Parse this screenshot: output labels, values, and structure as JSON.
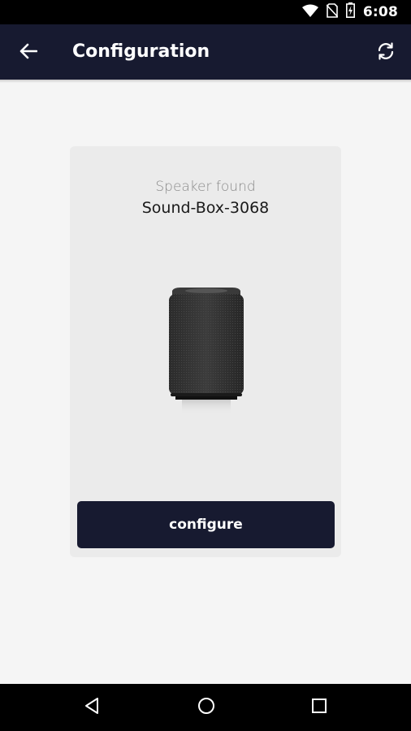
{
  "status_bar": {
    "time": "6:08",
    "icons": [
      "wifi-icon",
      "no-sim-icon",
      "battery-charging-icon"
    ]
  },
  "app_bar": {
    "title": "Configuration",
    "back_icon": "arrow-left-icon",
    "refresh_icon": "refresh-icon"
  },
  "card": {
    "status_label": "Speaker found",
    "device_name": "Sound-Box-3068",
    "configure_label": "configure"
  },
  "nav_bar": {
    "icons": [
      "back-triangle-icon",
      "home-circle-icon",
      "recents-square-icon"
    ]
  },
  "colors": {
    "primary": "#171a30",
    "background": "#f5f5f5",
    "card": "#ebebeb"
  }
}
